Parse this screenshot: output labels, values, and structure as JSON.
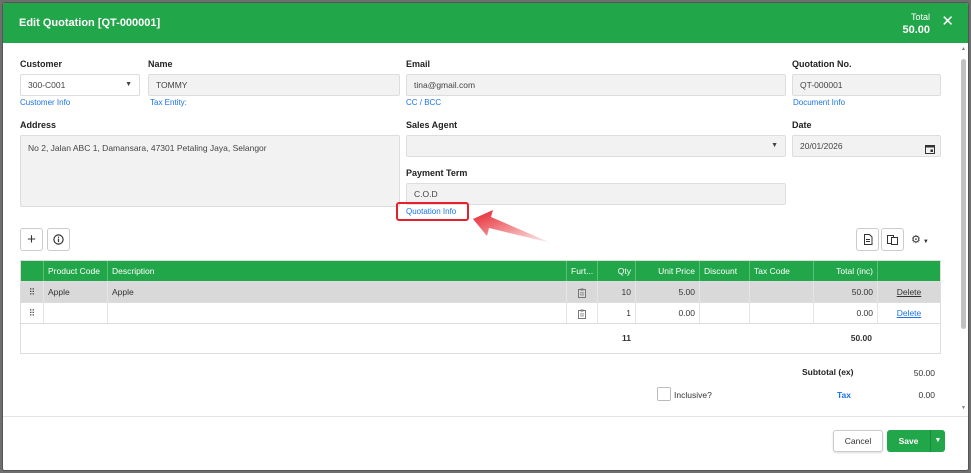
{
  "header": {
    "title": "Edit Quotation [QT-000001]",
    "total_label": "Total",
    "total_value": "50.00",
    "close_label": "✕"
  },
  "form": {
    "customer": {
      "label": "Customer",
      "value": "300-C001",
      "link": "Customer Info"
    },
    "name": {
      "label": "Name",
      "value": "TOMMY",
      "link": "Tax Entity:"
    },
    "email": {
      "label": "Email",
      "value": "tina@gmail.com",
      "link": "CC / BCC"
    },
    "quotation_no": {
      "label": "Quotation No.",
      "value": "QT-000001",
      "link": "Document Info"
    },
    "address": {
      "label": "Address",
      "value": "No 2, Jalan ABC 1, Damansara, 47301 Petaling Jaya, Selangor"
    },
    "sales_agent": {
      "label": "Sales Agent",
      "value": ""
    },
    "date": {
      "label": "Date",
      "value": "20/01/2026"
    },
    "payment_term": {
      "label": "Payment Term",
      "value": "C.O.D",
      "link": "Quotation Info"
    }
  },
  "grid": {
    "columns": [
      "",
      "Product Code",
      "Description",
      "Furt...",
      "Qty",
      "Unit Price",
      "Discount",
      "Tax Code",
      "Total (inc)",
      ""
    ],
    "rows": [
      {
        "product_code": "Apple",
        "description": "Apple",
        "qty": "10",
        "unit_price": "5.00",
        "discount": "",
        "tax_code": "",
        "total": "50.00",
        "action": "Delete"
      },
      {
        "product_code": "",
        "description": "",
        "qty": "1",
        "unit_price": "0.00",
        "discount": "",
        "tax_code": "",
        "total": "0.00",
        "action": "Delete"
      }
    ],
    "footer_qty": "11",
    "footer_total": "50.00"
  },
  "summary": {
    "subtotal_label": "Subtotal (ex)",
    "subtotal_value": "50.00",
    "inclusive_label": "Inclusive?",
    "tax_label": "Tax",
    "tax_value": "0.00"
  },
  "footer": {
    "cancel_label": "Cancel",
    "save_label": "Save"
  },
  "colors": {
    "brand_green": "#22a64a",
    "link_blue": "#1a73e8",
    "highlight_red": "#e5212b"
  },
  "icons": [
    "close-icon",
    "caret-down-icon",
    "calendar-icon",
    "plus-icon",
    "info-icon",
    "drag-handle-icon",
    "clipboard-icon",
    "document-icon",
    "copy-icon",
    "gear-icon",
    "arrow-icon"
  ]
}
